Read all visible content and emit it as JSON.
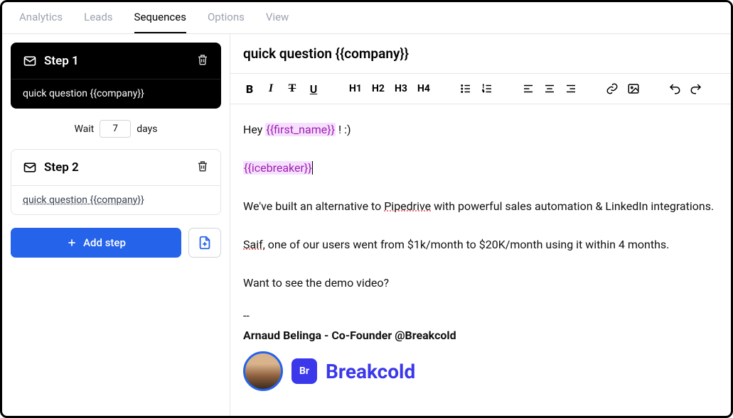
{
  "nav": {
    "items": [
      "Analytics",
      "Leads",
      "Sequences",
      "Options",
      "View"
    ],
    "active_index": 2
  },
  "sidebar": {
    "steps": [
      {
        "title": "Step 1",
        "subject": "quick question {{company}}",
        "active": true
      },
      {
        "title": "Step 2",
        "subject": "quick question {{company}}",
        "active": false
      }
    ],
    "wait": {
      "label_before": "Wait",
      "value": "7",
      "label_after": "days"
    },
    "add_step_label": "Add step"
  },
  "editor": {
    "subject": "quick question {{company}}",
    "toolbar": {
      "headings": [
        "H1",
        "H2",
        "H3",
        "H4"
      ]
    },
    "body": {
      "greeting_prefix": "Hey ",
      "var_first_name": "{{first_name}}",
      "greeting_suffix": " ! :)",
      "var_icebreaker": "{{icebreaker}}",
      "line_alt_1": "We've built an alternative to ",
      "alt_brand": "Pipedrive",
      "line_alt_2": " with powerful sales automation & LinkedIn integrations.",
      "user_name": "Saif",
      "line_story": ", one of our users went from $1k/month to $20K/month using it within 4 months.",
      "line_cta": "Want to see the demo video?",
      "sig_sep": "--",
      "signature": "Arnaud Belinga - Co-Founder @Breakcold",
      "brand_badge": "Br",
      "brand_name": "Breakcold"
    }
  }
}
